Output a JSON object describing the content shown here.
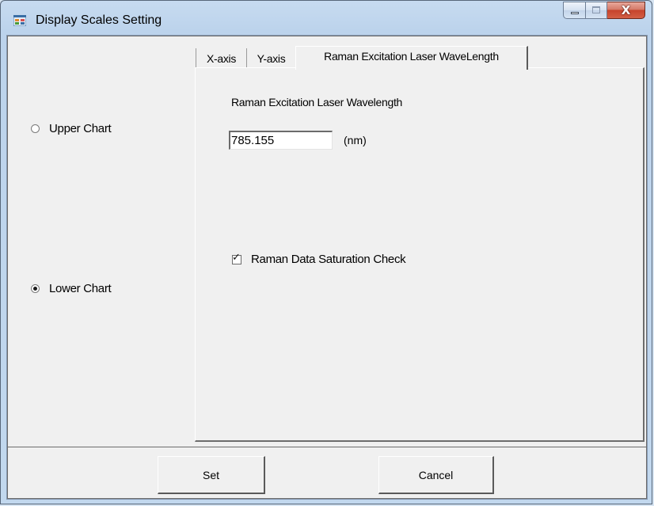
{
  "window": {
    "title": "Display Scales Setting",
    "icon": "form-app-icon",
    "caption": {
      "minimize_icon": "minimize-icon",
      "maximize_icon": "maximize-icon",
      "close_glyph": "X"
    }
  },
  "chart_select": {
    "options": [
      {
        "label": "Upper Chart",
        "checked": false
      },
      {
        "label": "Lower Chart",
        "checked": true
      }
    ]
  },
  "tabs": {
    "items": [
      "X-axis",
      "Y-axis",
      "Raman Excitation Laser WaveLength"
    ],
    "active": "Raman Excitation Laser WaveLength"
  },
  "panel": {
    "wavelength_label": "Raman Excitation Laser Wavelength",
    "wavelength_value": "785.155",
    "wavelength_unit": "(nm)",
    "saturation_label": "Raman Data Saturation Check",
    "saturation_checked": true,
    "check_glyph": "✓"
  },
  "buttons": {
    "set": "Set",
    "cancel": "Cancel"
  }
}
